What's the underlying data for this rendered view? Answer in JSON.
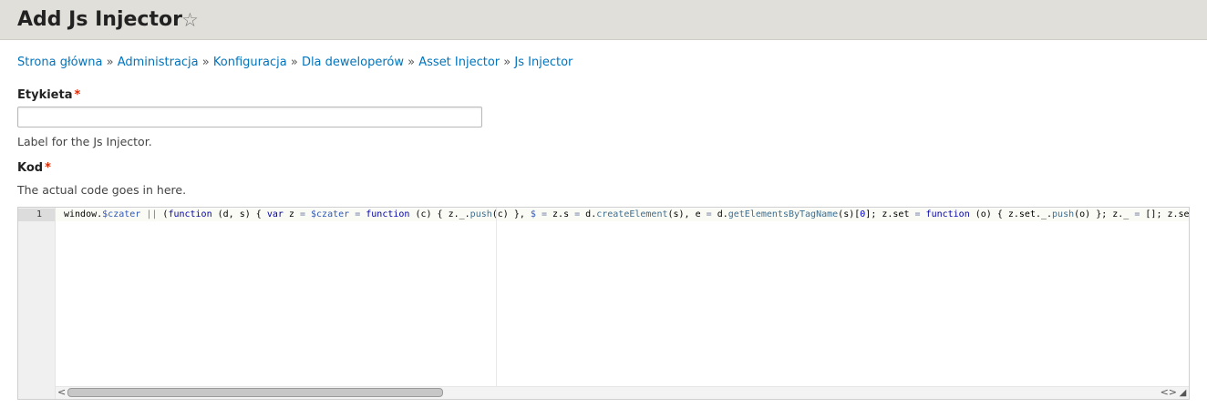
{
  "page": {
    "title": "Add Js Injector",
    "favorite_icon": "star-outline-icon"
  },
  "breadcrumb": {
    "items": [
      "Strona główna",
      "Administracja",
      "Konfiguracja",
      "Dla deweloperów",
      "Asset Injector",
      "Js Injector"
    ],
    "separator": "»"
  },
  "form": {
    "label_field": {
      "label": "Etykieta",
      "required_mark": "*",
      "value": "",
      "description": "Label for the Js Injector."
    },
    "code_field": {
      "label": "Kod",
      "required_mark": "*",
      "description": "The actual code goes in here."
    }
  },
  "editor": {
    "line_numbers": [
      "1"
    ],
    "code": "window.$czater || (function (d, s) { var z = $czater = function (c) { z._.push(c) }, $ = z.s = d.createElement(s), e = d.getElementsByTagName(s)[0]; z.set = function (o) { z.set._.push(o) }; z._ = []; z.se",
    "scroll_left_icon": "chevron-left-icon",
    "scroll_right_icon": "chevron-right-icon"
  },
  "colors": {
    "header_bg": "#e0dfd9",
    "link": "#0074bd",
    "required": "#e32700"
  }
}
